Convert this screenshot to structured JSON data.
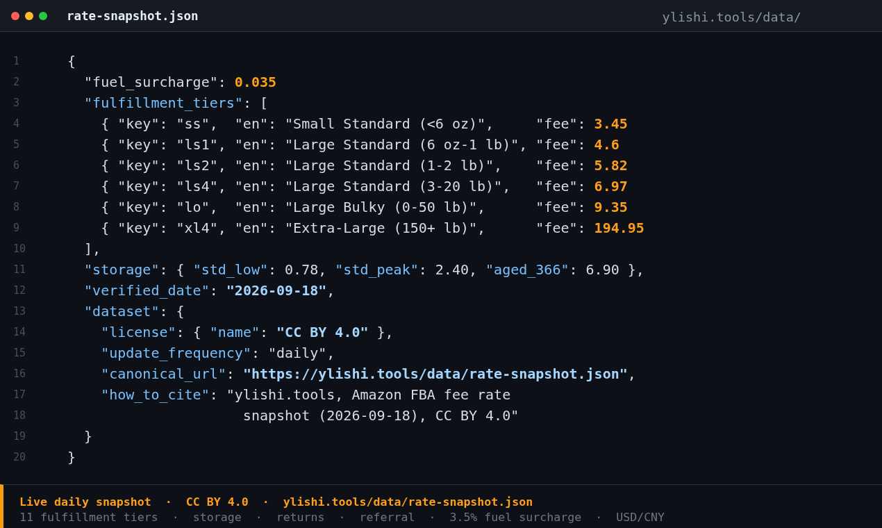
{
  "window": {
    "title": "rate-snapshot.json",
    "location": "ylishi.tools/data/"
  },
  "code_lines": [
    {
      "number": "1",
      "tokens": [
        {
          "text": "{",
          "kind": "plain"
        }
      ]
    },
    {
      "number": "2",
      "tokens": [
        {
          "text": "  \"fuel_surcharge\": ",
          "kind": "plain"
        },
        {
          "text": "0.035",
          "kind": "number"
        }
      ]
    },
    {
      "number": "3",
      "tokens": [
        {
          "text": "  \"fulfillment_tiers\"",
          "kind": "key"
        },
        {
          "text": ": [",
          "kind": "plain"
        }
      ]
    },
    {
      "number": "4",
      "tokens": [
        {
          "text": "    { \"key\": \"ss\",  \"en\": \"Small Standard (<6 oz)\",     \"fee\": ",
          "kind": "plain"
        },
        {
          "text": "3.45",
          "kind": "number"
        }
      ]
    },
    {
      "number": "5",
      "tokens": [
        {
          "text": "    { \"key\": \"ls1\", \"en\": \"Large Standard (6 oz-1 lb)\", \"fee\": ",
          "kind": "plain"
        },
        {
          "text": "4.6",
          "kind": "number"
        }
      ]
    },
    {
      "number": "6",
      "tokens": [
        {
          "text": "    { \"key\": \"ls2\", \"en\": \"Large Standard (1-2 lb)\",    \"fee\": ",
          "kind": "plain"
        },
        {
          "text": "5.82",
          "kind": "number"
        }
      ]
    },
    {
      "number": "7",
      "tokens": [
        {
          "text": "    { \"key\": \"ls4\", \"en\": \"Large Standard (3-20 lb)\",   \"fee\": ",
          "kind": "plain"
        },
        {
          "text": "6.97",
          "kind": "number"
        }
      ]
    },
    {
      "number": "8",
      "tokens": [
        {
          "text": "    { \"key\": \"lo\",  \"en\": \"Large Bulky (0-50 lb)\",      \"fee\": ",
          "kind": "plain"
        },
        {
          "text": "9.35",
          "kind": "number"
        }
      ]
    },
    {
      "number": "9",
      "tokens": [
        {
          "text": "    { \"key\": \"xl4\", \"en\": \"Extra-Large (150+ lb)\",      \"fee\": ",
          "kind": "plain"
        },
        {
          "text": "194.95",
          "kind": "number"
        }
      ]
    },
    {
      "number": "10",
      "tokens": [
        {
          "text": "  ],",
          "kind": "plain"
        }
      ]
    },
    {
      "number": "11",
      "tokens": [
        {
          "text": "  \"storage\"",
          "kind": "key"
        },
        {
          "text": ": { ",
          "kind": "plain"
        },
        {
          "text": "\"std_low\"",
          "kind": "key"
        },
        {
          "text": ": 0.78, ",
          "kind": "plain"
        },
        {
          "text": "\"std_peak\"",
          "kind": "key"
        },
        {
          "text": ": 2.40, ",
          "kind": "plain"
        },
        {
          "text": "\"aged_366\"",
          "kind": "key"
        },
        {
          "text": ": 6.90 },",
          "kind": "plain"
        }
      ]
    },
    {
      "number": "12",
      "tokens": [
        {
          "text": "  \"verified_date\"",
          "kind": "key"
        },
        {
          "text": ": ",
          "kind": "plain"
        },
        {
          "text": "\"2026-09-18\"",
          "kind": "string"
        },
        {
          "text": ",",
          "kind": "plain"
        }
      ]
    },
    {
      "number": "13",
      "tokens": [
        {
          "text": "  \"dataset\"",
          "kind": "key"
        },
        {
          "text": ": {",
          "kind": "plain"
        }
      ]
    },
    {
      "number": "14",
      "tokens": [
        {
          "text": "    \"license\"",
          "kind": "key"
        },
        {
          "text": ": { ",
          "kind": "plain"
        },
        {
          "text": "\"name\"",
          "kind": "key"
        },
        {
          "text": ": ",
          "kind": "plain"
        },
        {
          "text": "\"CC BY 4.0\"",
          "kind": "string"
        },
        {
          "text": " },",
          "kind": "plain"
        }
      ]
    },
    {
      "number": "15",
      "tokens": [
        {
          "text": "    \"update_frequency\"",
          "kind": "key"
        },
        {
          "text": ": \"daily\",",
          "kind": "plain"
        }
      ]
    },
    {
      "number": "16",
      "tokens": [
        {
          "text": "    \"canonical_url\"",
          "kind": "key"
        },
        {
          "text": ": ",
          "kind": "plain"
        },
        {
          "text": "\"https://ylishi.tools/data/rate-snapshot.json\"",
          "kind": "string"
        },
        {
          "text": ",",
          "kind": "plain"
        }
      ]
    },
    {
      "number": "17",
      "tokens": [
        {
          "text": "    \"how_to_cite\"",
          "kind": "key"
        },
        {
          "text": ": \"ylishi.tools, Amazon FBA fee rate",
          "kind": "plain"
        }
      ]
    },
    {
      "number": "18",
      "tokens": [
        {
          "text": "                     snapshot (2026-09-18), CC BY 4.0\"",
          "kind": "plain"
        }
      ]
    },
    {
      "number": "19",
      "tokens": [
        {
          "text": "  }",
          "kind": "plain"
        }
      ]
    },
    {
      "number": "20",
      "tokens": [
        {
          "text": "}",
          "kind": "plain"
        }
      ]
    }
  ],
  "status_bar": {
    "headline": "Live daily snapshot  ·  CC BY 4.0  ·  ylishi.tools/data/rate-snapshot.json",
    "details": "11 fulfillment tiers  ·  storage  ·  returns  ·  referral  ·  3.5% fuel surcharge  ·  USD/CNY"
  }
}
